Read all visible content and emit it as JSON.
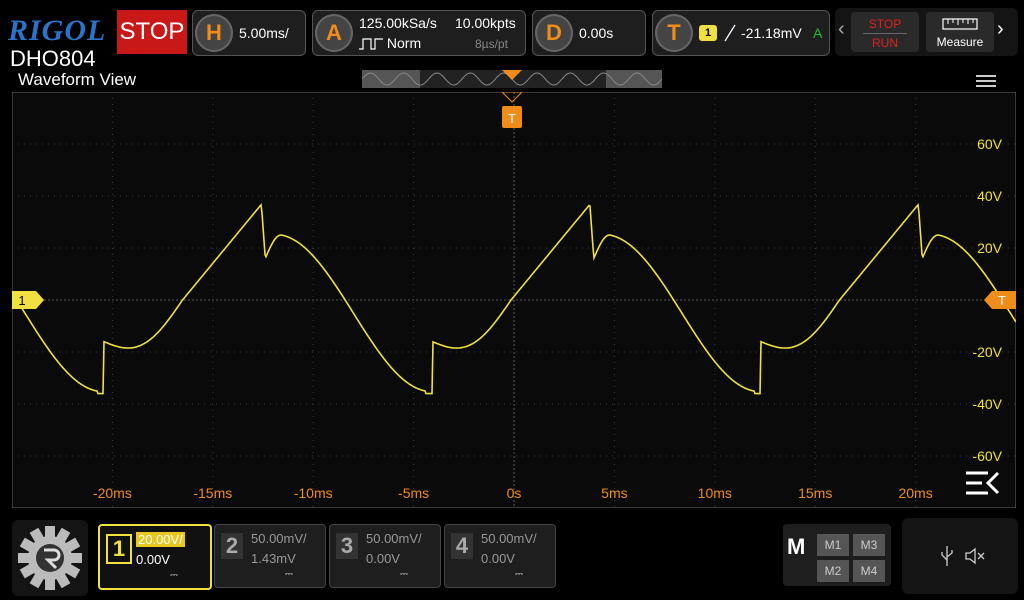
{
  "brand": {
    "logo": "RIGOL",
    "model": "DHO804",
    "run_state": "STOP"
  },
  "timebase": {
    "letter": "H",
    "scale": "5.00ms/"
  },
  "acquire": {
    "letter": "A",
    "sample_rate": "125.00kSa/s",
    "mode": "Norm",
    "memory_depth": "10.00kpts",
    "resolution": "8µs/pt"
  },
  "delay": {
    "letter": "D",
    "value": "0.00s"
  },
  "trigger": {
    "letter": "T",
    "source": "1",
    "slope_icon": "rising-edge-icon",
    "level": "-21.18mV",
    "sweep": "A"
  },
  "controls": {
    "stop_label": "STOP",
    "run_label": "RUN",
    "measure_label": "Measure"
  },
  "waveform": {
    "title": "Waveform View",
    "trigger_marker": "T",
    "channel_marker": "1",
    "right_marker": "T",
    "v_labels": [
      "60V",
      "40V",
      "20V",
      "-20V",
      "-40V",
      "-60V"
    ],
    "t_labels": [
      "-20ms",
      "-15ms",
      "-10ms",
      "-5ms",
      "0s",
      "5ms",
      "10ms",
      "15ms",
      "20ms"
    ]
  },
  "channels": [
    {
      "num": "1",
      "scale": "20.00V/",
      "offset": "0.00V",
      "active": true,
      "color": "#f0e040"
    },
    {
      "num": "2",
      "scale": "50.00mV/",
      "offset": "1.43mV",
      "active": false,
      "color": "#888888"
    },
    {
      "num": "3",
      "scale": "50.00mV/",
      "offset": "0.00V",
      "active": false,
      "color": "#888888"
    },
    {
      "num": "4",
      "scale": "50.00mV/",
      "offset": "0.00V",
      "active": false,
      "color": "#888888"
    }
  ],
  "math": {
    "label": "M",
    "m1": "M1",
    "m2": "M2",
    "m3": "M3",
    "m4": "M4"
  },
  "colors": {
    "trace": "#f0e040",
    "accent": "#f08c1a",
    "grid": "#3a3a3a"
  }
}
